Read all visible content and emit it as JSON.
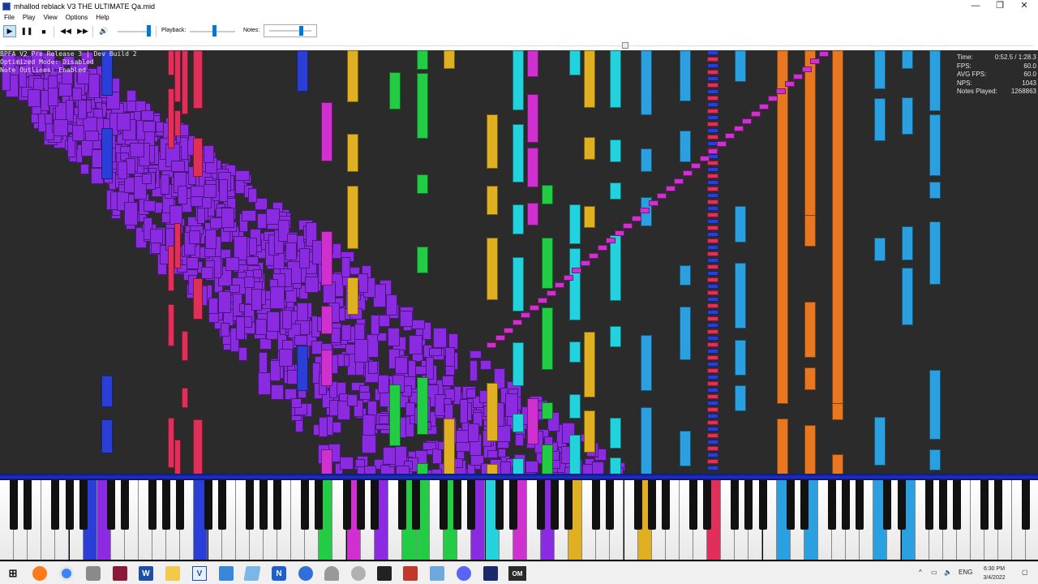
{
  "window": {
    "title": "mhallod reblack V3 THE ULTIMATE Qa.mid",
    "minimize_glyph": "—",
    "maximize_glyph": "❐",
    "close_glyph": "✕"
  },
  "menu": [
    "File",
    "Play",
    "View",
    "Options",
    "Help"
  ],
  "toolbar": {
    "play_glyph": "▶",
    "pause_glyph": "❚❚",
    "stop_glyph": "■",
    "rewind_glyph": "◀◀",
    "forward_glyph": "▶▶",
    "volume_glyph": "🔊",
    "playback_label": "Playback:",
    "notes_label": "Notes:"
  },
  "levels": {
    "volume": 0.9,
    "playback_speed": 0.5,
    "notes": 0.75,
    "song_progress": 0.6
  },
  "overlay_info": [
    "BPFA V2 Pre Release 3 | Dev Build 2",
    "Optimized Mode: Disabled",
    "Note Outlines: Enabled"
  ],
  "stats": [
    {
      "label": "Time:",
      "value": "0:52.5 / 1:28.3"
    },
    {
      "label": "FPS:",
      "value": "60.0"
    },
    {
      "label": "AVG FPS:",
      "value": "60.0"
    },
    {
      "label": "NPS:",
      "value": "1043"
    },
    {
      "label": "Notes Played:",
      "value": "1268863"
    }
  ],
  "colors": {
    "roll_background": "#2b2b2b",
    "purple": "#8a2be2",
    "green": "#22cc44",
    "cyan": "#22d3dd",
    "magenta": "#d030d0",
    "gold": "#e0b020",
    "orange": "#e87722",
    "blue": "#2a3fd8",
    "sky": "#2aa0e0",
    "red": "#e0305a"
  },
  "taskbar": {
    "apps": [
      "start-icon",
      "firefox-icon",
      "chrome-icon",
      "explorer-icon",
      "winrar-icon",
      "word-icon",
      "files-icon",
      "vegas-icon",
      "paint-icon",
      "scripts-icon",
      "n-app-icon",
      "s-app-icon",
      "pen-icon",
      "ball-icon",
      "terminal-icon",
      "puzzle-icon",
      "notepad-icon",
      "discord-icon",
      "piano-icon",
      "om-icon"
    ],
    "om_label": "OM",
    "w_label": "W",
    "v_label": "V",
    "n_label": "N",
    "tray_chevron": "^",
    "language": "ENG",
    "time": "6:30 PM",
    "date": "3/4/2022"
  }
}
